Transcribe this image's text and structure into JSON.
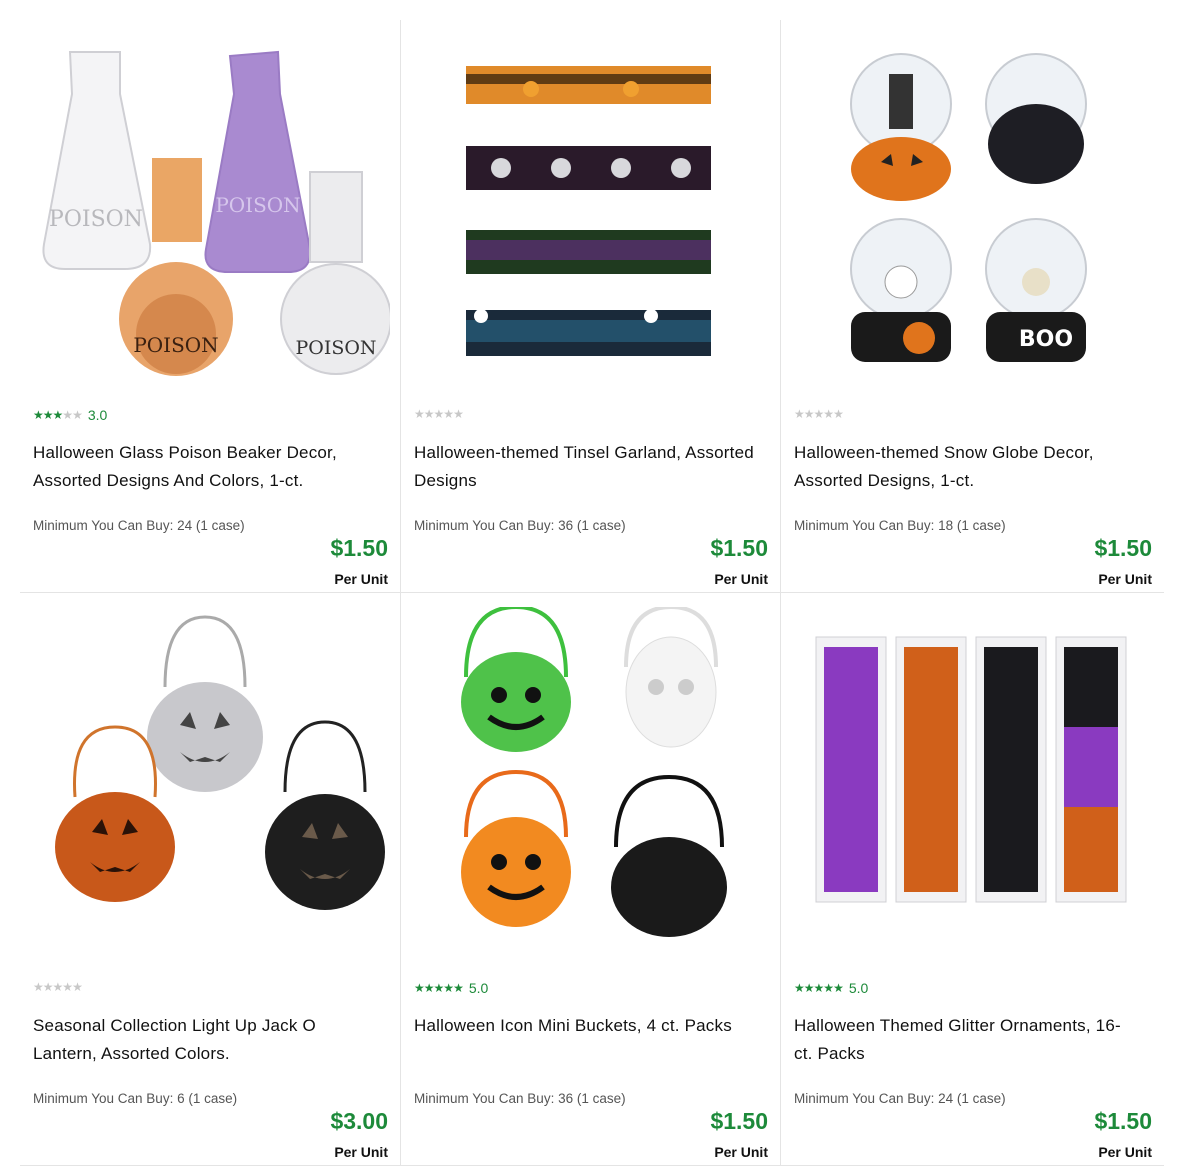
{
  "products": [
    {
      "rating": 3,
      "rating_text": "3.0",
      "title": "Halloween Glass Poison Beaker Decor, Assorted Designs And Colors, 1-ct.",
      "minimum": "Minimum You Can Buy: 24 (1 case)",
      "price": "$1.50",
      "unit": "Per Unit",
      "image_label": "POISON"
    },
    {
      "rating": 0,
      "rating_text": "",
      "title": "Halloween-themed Tinsel Garland, Assorted Designs",
      "minimum": "Minimum You Can Buy: 36 (1 case)",
      "price": "$1.50",
      "unit": "Per Unit"
    },
    {
      "rating": 0,
      "rating_text": "",
      "title": "Halloween-themed Snow Globe Decor, Assorted Designs, 1-ct.",
      "minimum": "Minimum You Can Buy: 18 (1 case)",
      "price": "$1.50",
      "unit": "Per Unit",
      "image_label": "BOO"
    },
    {
      "rating": 0,
      "rating_text": "",
      "title": "Seasonal Collection Light Up Jack O Lantern, Assorted Colors.",
      "minimum": "Minimum You Can Buy: 6 (1 case)",
      "price": "$3.00",
      "unit": "Per Unit"
    },
    {
      "rating": 5,
      "rating_text": "5.0",
      "title": "Halloween Icon Mini Buckets, 4 ct. Packs",
      "minimum": "Minimum You Can Buy: 36 (1 case)",
      "price": "$1.50",
      "unit": "Per Unit"
    },
    {
      "rating": 5,
      "rating_text": "5.0",
      "title": "Halloween Themed Glitter Ornaments, 16-ct. Packs",
      "minimum": "Minimum You Can Buy: 24 (1 case)",
      "price": "$1.50",
      "unit": "Per Unit"
    }
  ],
  "colors": {
    "price_green": "#1d8a3a",
    "star_on": "#1d8a3a",
    "star_off": "#c8c8c8"
  }
}
